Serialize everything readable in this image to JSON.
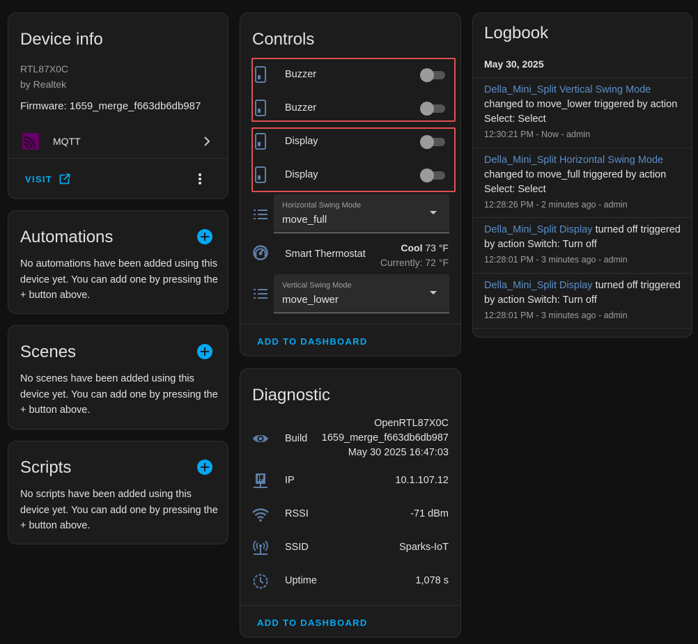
{
  "device_info": {
    "title": "Device info",
    "model": "RTL87X0C",
    "manufacturer": "by Realtek",
    "firmware": "Firmware: 1659_merge_f663db6db987",
    "integration": {
      "label": "MQTT",
      "icon": "mqtt-logo"
    },
    "visit_label": "VISIT"
  },
  "automations": {
    "title": "Automations",
    "text": "No automations have been added using this device yet. You can add one by pressing the + button above."
  },
  "scenes": {
    "title": "Scenes",
    "text": "No scenes have been added using this device yet. You can add one by pressing the + button above."
  },
  "scripts": {
    "title": "Scripts",
    "text": "No scripts have been added using this device yet. You can add one by pressing the + button above."
  },
  "controls": {
    "title": "Controls",
    "switches": [
      {
        "label": "Buzzer",
        "state": "off"
      },
      {
        "label": "Buzzer",
        "state": "off"
      },
      {
        "label": "Display",
        "state": "off"
      },
      {
        "label": "Display",
        "state": "off"
      }
    ],
    "horizontal_swing": {
      "label": "Horizontal Swing Mode",
      "value": "move_full"
    },
    "thermostat": {
      "label": "Smart Thermostat",
      "mode": "Cool",
      "target": "73 °F",
      "current": "Currently: 72 °F"
    },
    "vertical_swing": {
      "label": "Vertical Swing Mode",
      "value": "move_lower"
    },
    "add_label": "ADD TO DASHBOARD",
    "highlight_color": "#e14f4f"
  },
  "diagnostic": {
    "title": "Diagnostic",
    "build": {
      "label": "Build",
      "values": [
        "OpenRTL87X0C",
        "1659_merge_f663db6db987",
        "May 30 2025 16:47:03"
      ]
    },
    "ip": {
      "label": "IP",
      "value": "10.1.107.12"
    },
    "rssi": {
      "label": "RSSI",
      "value": "-71 dBm"
    },
    "ssid": {
      "label": "SSID",
      "value": "Sparks-IoT"
    },
    "uptime": {
      "label": "Uptime",
      "value": "1,078 s"
    },
    "add_label": "ADD TO DASHBOARD"
  },
  "logbook": {
    "title": "Logbook",
    "date": "May 30, 2025",
    "entries": [
      {
        "entity": "Della_Mini_Split Vertical Swing Mode",
        "line1_rest": "",
        "line2": "changed to move_lower triggered by action",
        "line3": "Select: Select",
        "meta": "12:30:21 PM - Now - admin"
      },
      {
        "entity": "Della_Mini_Split Horizontal Swing Mode",
        "line1_rest": "",
        "line2": "changed to move_full triggered by action",
        "line3": "Select: Select",
        "meta": "12:28:26 PM - 2 minutes ago - admin"
      },
      {
        "entity": "Della_Mini_Split Display",
        "line1_rest": " turned off triggered",
        "line2": "by action Switch: Turn off",
        "line3": "",
        "meta": "12:28:01 PM - 3 minutes ago - admin"
      },
      {
        "entity": "Della_Mini_Split Display",
        "line1_rest": " turned off triggered",
        "line2": "by action Switch: Turn off",
        "line3": "",
        "meta": "12:28:01 PM - 3 minutes ago - admin"
      }
    ]
  },
  "colors": {
    "background": "#111111",
    "card": "#1c1c1c",
    "accent": "#03a9f4",
    "entity_link": "#5b8fc7",
    "icon": "#5e7fa8"
  }
}
